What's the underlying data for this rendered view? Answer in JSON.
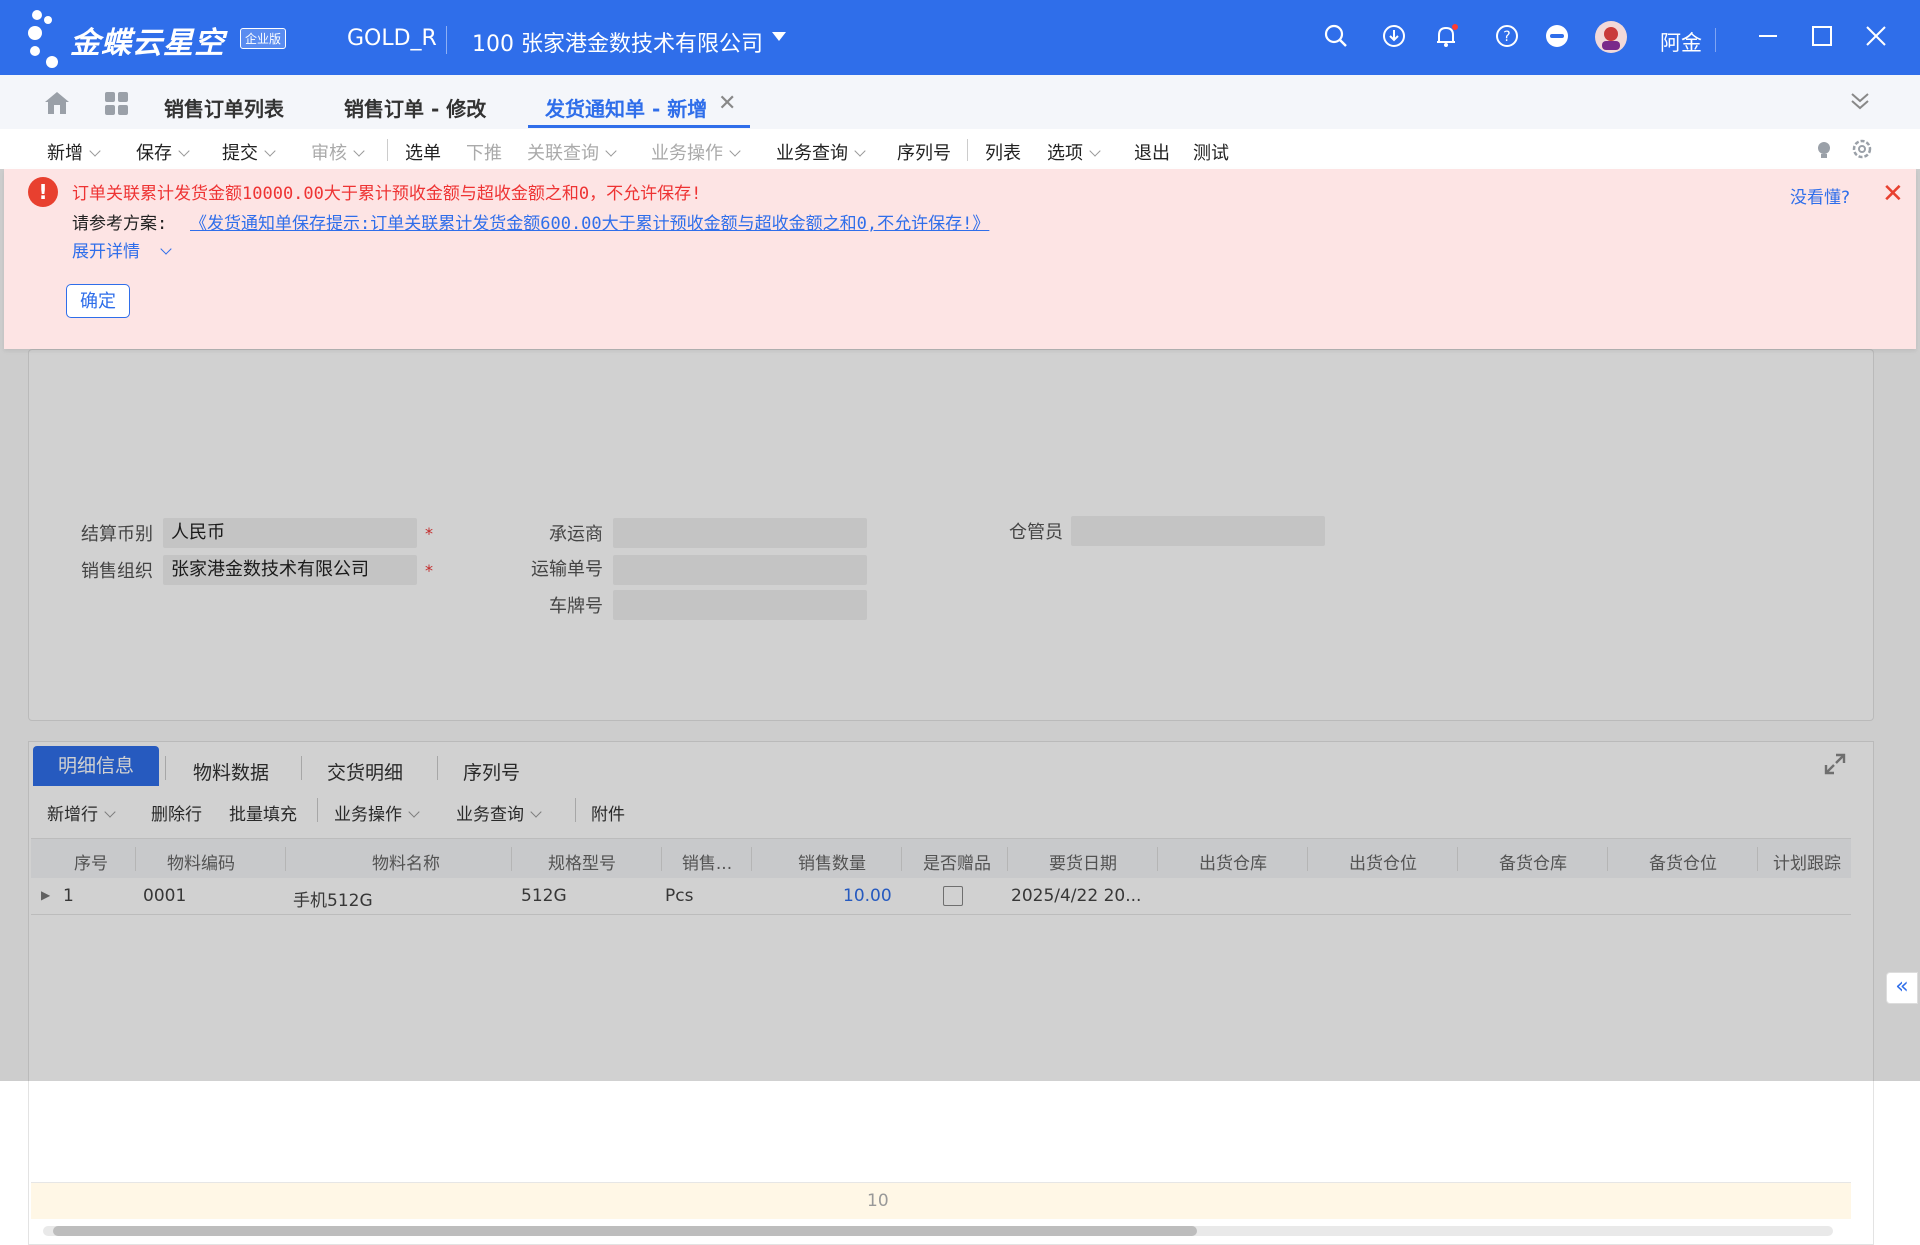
{
  "titlebar": {
    "brand": "金蝶云星空",
    "edition": "企业版",
    "database": "GOLD_R",
    "org": "100  张家港金数技术有限公司",
    "user": "阿金"
  },
  "tabs": [
    {
      "label": "销售订单列表"
    },
    {
      "label": "销售订单 - 修改"
    },
    {
      "label": "发货通知单 - 新增"
    }
  ],
  "toolbar": {
    "items": [
      "新增",
      "保存",
      "提交",
      "审核",
      "选单",
      "下推",
      "关联查询",
      "业务操作",
      "业务查询",
      "序列号",
      "列表",
      "选项",
      "退出",
      "测试"
    ]
  },
  "error": {
    "message": "订单关联累计发货金额10000.00大于累计预收金额与超收金额之和0，不允许保存!",
    "ref_label": "请参考方案:",
    "ref_link": "《发货通知单保存提示:订单关联累计发货金额600.00大于累计预收金额与超收金额之和0,不允许保存!》",
    "expand": "展开详情",
    "ok": "确定",
    "help": "没看懂?"
  },
  "form": {
    "currency_label": "结算币别",
    "currency_value": "人民币",
    "sale_org_label": "销售组织",
    "sale_org_value": "张家港金数技术有限公司",
    "carrier_label": "承运商",
    "waybill_label": "运输单号",
    "plate_label": "车牌号",
    "keeper_label": "仓管员"
  },
  "detail": {
    "tabs": [
      "明细信息",
      "物料数据",
      "交货明细",
      "序列号"
    ],
    "tools": [
      "新增行",
      "删除行",
      "批量填充",
      "业务操作",
      "业务查询",
      "附件"
    ],
    "columns": [
      "序号",
      "物料编码",
      "物料名称",
      "规格型号",
      "销售...",
      "销售数量",
      "是否赠品",
      "要货日期",
      "出货仓库",
      "出货仓位",
      "备货仓库",
      "备货仓位",
      "计划跟踪"
    ],
    "row": {
      "seq": "1",
      "code": "0001",
      "name": "手机512G",
      "spec": "512G",
      "unit": "Pcs",
      "qty": "10.00",
      "gift": false,
      "date": "2025/4/22 20..."
    },
    "footer_total": "10"
  },
  "colors": {
    "primary": "#2f6eea",
    "error": "#e8402f",
    "banner_bg": "#fde4e4"
  }
}
